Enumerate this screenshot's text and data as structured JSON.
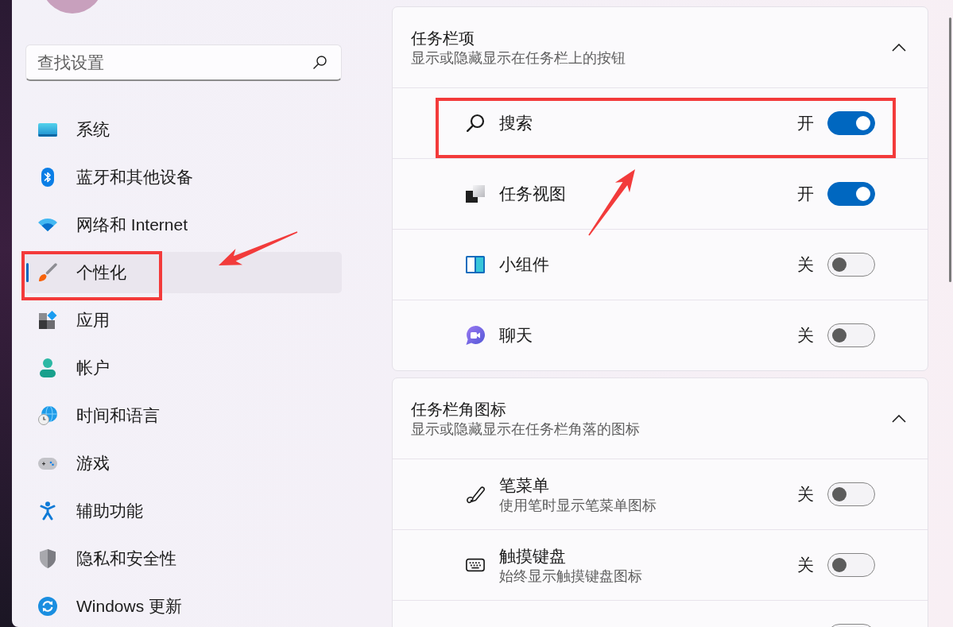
{
  "search": {
    "placeholder": "查找设置"
  },
  "nav_items": [
    {
      "label": "系统",
      "selected": false,
      "annotated": false
    },
    {
      "label": "蓝牙和其他设备",
      "selected": false,
      "annotated": false
    },
    {
      "label": "网络和 Internet",
      "selected": false,
      "annotated": false
    },
    {
      "label": "个性化",
      "selected": true,
      "annotated": true
    },
    {
      "label": "应用",
      "selected": false,
      "annotated": false
    },
    {
      "label": "帐户",
      "selected": false,
      "annotated": false
    },
    {
      "label": "时间和语言",
      "selected": false,
      "annotated": false
    },
    {
      "label": "游戏",
      "selected": false,
      "annotated": false
    },
    {
      "label": "辅助功能",
      "selected": false,
      "annotated": false
    },
    {
      "label": "隐私和安全性",
      "selected": false,
      "annotated": false
    },
    {
      "label": "Windows 更新",
      "selected": false,
      "annotated": false
    }
  ],
  "sections": [
    {
      "title": "任务栏项",
      "description": "显示或隐藏显示在任务栏上的按钮",
      "expanded": true,
      "items": [
        {
          "label": "搜索",
          "state_text": "开",
          "on": true,
          "annotated": true
        },
        {
          "label": "任务视图",
          "state_text": "开",
          "on": true,
          "annotated": false
        },
        {
          "label": "小组件",
          "state_text": "关",
          "on": false,
          "annotated": false
        },
        {
          "label": "聊天",
          "state_text": "关",
          "on": false,
          "annotated": false
        }
      ]
    },
    {
      "title": "任务栏角图标",
      "description": "显示或隐藏显示在任务栏角落的图标",
      "expanded": true,
      "items": [
        {
          "label": "笔菜单",
          "description": "使用笔时显示笔菜单图标",
          "state_text": "关",
          "on": false,
          "annotated": false
        },
        {
          "label": "触摸键盘",
          "description": "始终显示触摸键盘图标",
          "state_text": "关",
          "on": false,
          "annotated": false
        },
        {
          "on": false,
          "annotated": false
        }
      ]
    }
  ]
}
